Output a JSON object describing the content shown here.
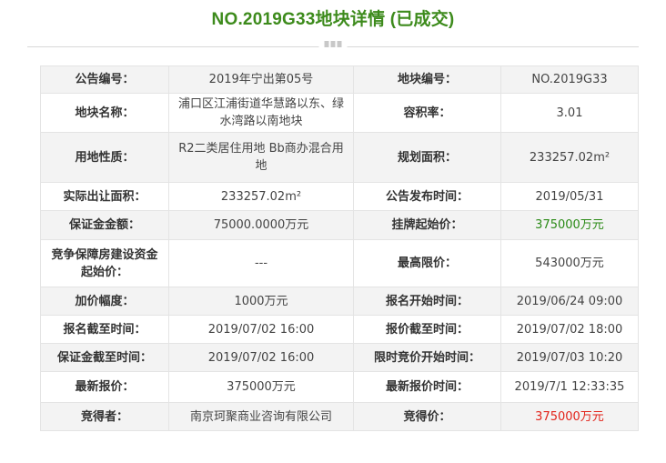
{
  "page": {
    "title": "NO.2019G33地块详情 (已成交)"
  },
  "colors": {
    "title": "#3d8b1c",
    "price_green": "#2a8a16",
    "price_red": "#e2231a"
  },
  "icons": {
    "divider": "three-squares-divider-icon"
  },
  "rows": [
    {
      "l1": "公告编号：",
      "v1": "2019年宁出第05号",
      "l2": "地块编号：",
      "v2": "NO.2019G33"
    },
    {
      "l1": "地块名称：",
      "v1": "浦口区江浦街道华慧路以东、绿水湾路以南地块",
      "l2": "容积率：",
      "v2": "3.01"
    },
    {
      "l1": "用地性质：",
      "v1": "R2二类居住用地 Bb商办混合用地",
      "l2": "规划面积：",
      "v2": "233257.02m²"
    },
    {
      "l1": "实际出让面积：",
      "v1": "233257.02m²",
      "l2": "公告发布时间：",
      "v2": "2019/05/31"
    },
    {
      "l1": "保证金金额：",
      "v1": "75000.0000万元",
      "l2": "挂牌起始价：",
      "v2": "375000万元"
    },
    {
      "l1": "竞争保障房建设资金起始价：",
      "v1": "---",
      "l2": "最高限价：",
      "v2": "543000万元"
    },
    {
      "l1": "加价幅度：",
      "v1": "1000万元",
      "l2": "报名开始时间：",
      "v2": "2019/06/24 09:00"
    },
    {
      "l1": "报名截至时间：",
      "v1": "2019/07/02 16:00",
      "l2": "报价截至时间：",
      "v2": "2019/07/02 18:00"
    },
    {
      "l1": "保证金截至时间：",
      "v1": "2019/07/02 16:00",
      "l2": "限时竞价开始时间：",
      "v2": "2019/07/03 10:20"
    },
    {
      "l1": "最新报价：",
      "v1": "375000万元",
      "l2": "最新报价时间：",
      "v2": "2019/7/1 12:33:35"
    },
    {
      "l1": "竞得者：",
      "v1": "南京珂聚商业咨询有限公司",
      "l2": "竞得价：",
      "v2": "375000万元"
    }
  ]
}
